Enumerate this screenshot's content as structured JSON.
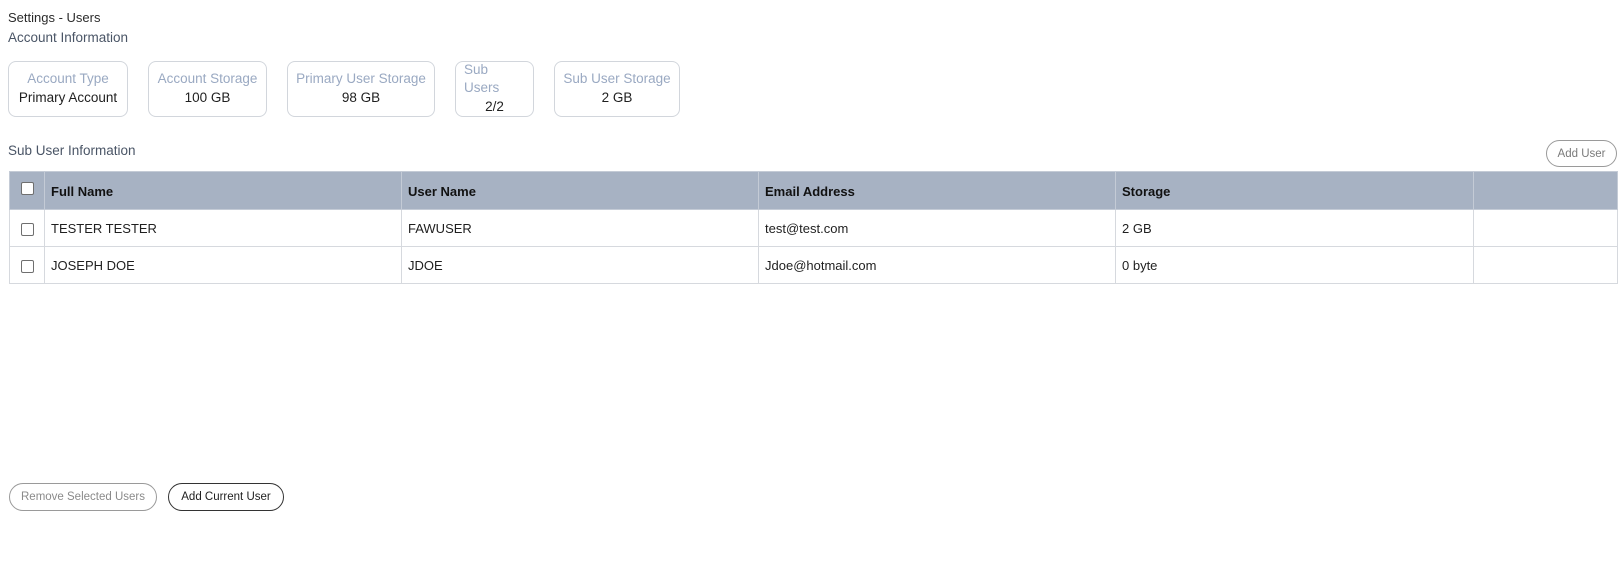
{
  "page": {
    "title": "Settings - Users"
  },
  "account": {
    "section_title": "Account Information",
    "cards": [
      {
        "label": "Account Type",
        "value": "Primary Account"
      },
      {
        "label": "Account Storage",
        "value": "100 GB"
      },
      {
        "label": "Primary User Storage",
        "value": "98 GB"
      },
      {
        "label": "Sub Users",
        "value": "2/2"
      },
      {
        "label": "Sub User Storage",
        "value": "2 GB"
      }
    ]
  },
  "subusers": {
    "section_title": "Sub User Information",
    "add_user_label": "Add User",
    "columns": [
      "Full Name",
      "User Name",
      "Email Address",
      "Storage",
      ""
    ],
    "rows": [
      {
        "full_name": "TESTER TESTER",
        "user_name": "FAWUSER",
        "email": "test@test.com",
        "storage": "2 GB",
        "extra": ""
      },
      {
        "full_name": "JOSEPH DOE",
        "user_name": "JDOE",
        "email": "Jdoe@hotmail.com",
        "storage": "0 byte",
        "extra": ""
      }
    ]
  },
  "footer": {
    "remove_label": "Remove Selected Users",
    "add_current_label": "Add Current User"
  },
  "colors": {
    "table_header_bg": "#a7b2c3",
    "card_label": "#9aa9c2",
    "section_title": "#4a5566"
  }
}
